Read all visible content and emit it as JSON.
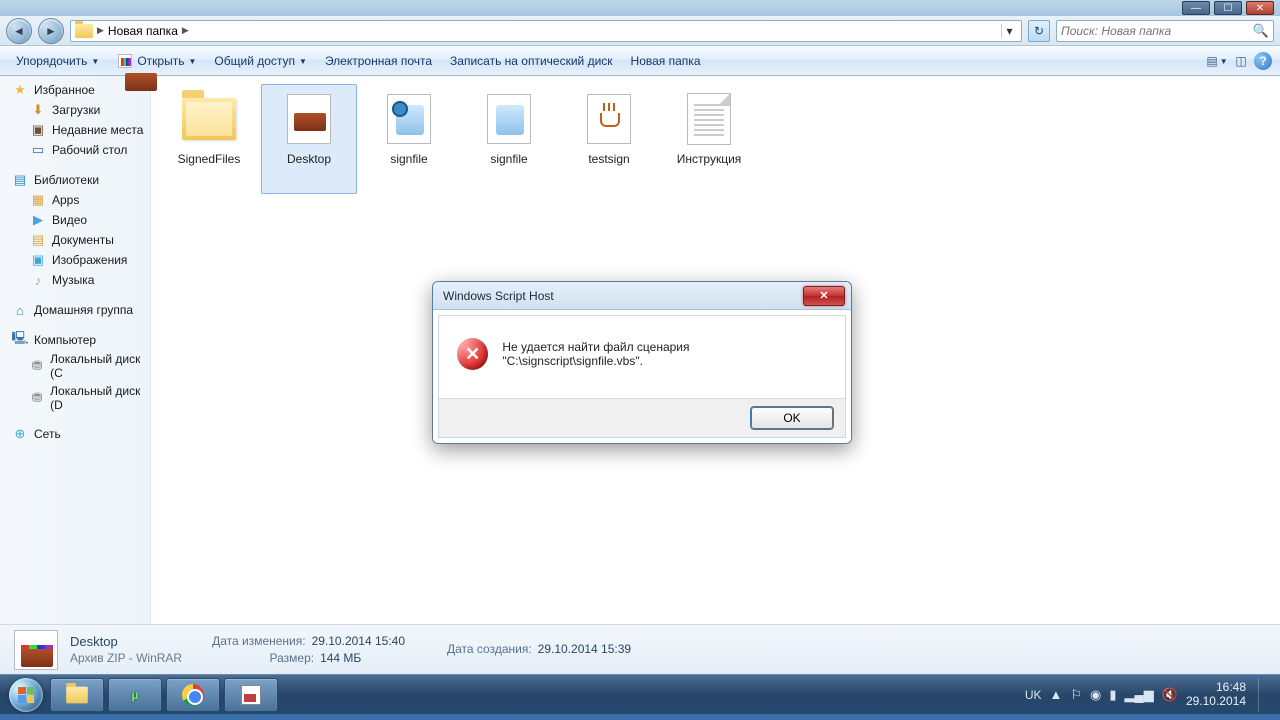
{
  "window_controls": {
    "minimize": "—",
    "maximize": "☐",
    "close": "✕"
  },
  "breadcrumb": {
    "current": "Новая папка",
    "arrow1": "▶",
    "arrow2": "▶",
    "dropdown": "▾"
  },
  "search": {
    "placeholder": "Поиск: Новая папка"
  },
  "toolbar": {
    "organize": "Упорядочить",
    "open": "Открыть",
    "share": "Общий доступ",
    "email": "Электронная почта",
    "burn": "Записать на оптический диск",
    "newfolder": "Новая папка",
    "help_char": "?"
  },
  "sidebar": {
    "favorites": {
      "title": "Избранное",
      "downloads": "Загрузки",
      "recent": "Недавние места",
      "desktop": "Рабочий стол"
    },
    "libraries": {
      "title": "Библиотеки",
      "apps": "Apps",
      "video": "Видео",
      "documents": "Документы",
      "images": "Изображения",
      "music": "Музыка"
    },
    "homegroup": {
      "title": "Домашняя группа"
    },
    "computer": {
      "title": "Компьютер",
      "c": "Локальный диск (C",
      "d": "Локальный диск (D"
    },
    "network": {
      "title": "Сеть"
    }
  },
  "files": {
    "f1": "SignedFiles",
    "f2": "Desktop",
    "f3": "signfile",
    "f4": "signfile",
    "f5": "testsign",
    "f6": "Инструкция"
  },
  "details": {
    "name": "Desktop",
    "type": "Архив ZIP - WinRAR",
    "mod_label": "Дата изменения:",
    "mod_val": "29.10.2014 15:40",
    "size_label": "Размер:",
    "size_val": "144 МБ",
    "created_label": "Дата создания:",
    "created_val": "29.10.2014 15:39"
  },
  "dialog": {
    "title": "Windows Script Host",
    "message": "Не удается найти файл сценария \"C:\\signscript\\signfile.vbs\".",
    "ok": "OK",
    "close_char": "✕",
    "error_char": "✕"
  },
  "tray": {
    "lang": "UK",
    "flag_char": "▲",
    "action_char": "⚐",
    "net_char": "◉",
    "bat_char": "▮",
    "wifi_char": "▂▄▆",
    "vol_char": "🔇",
    "time": "16:48",
    "date": "29.10.2014"
  }
}
